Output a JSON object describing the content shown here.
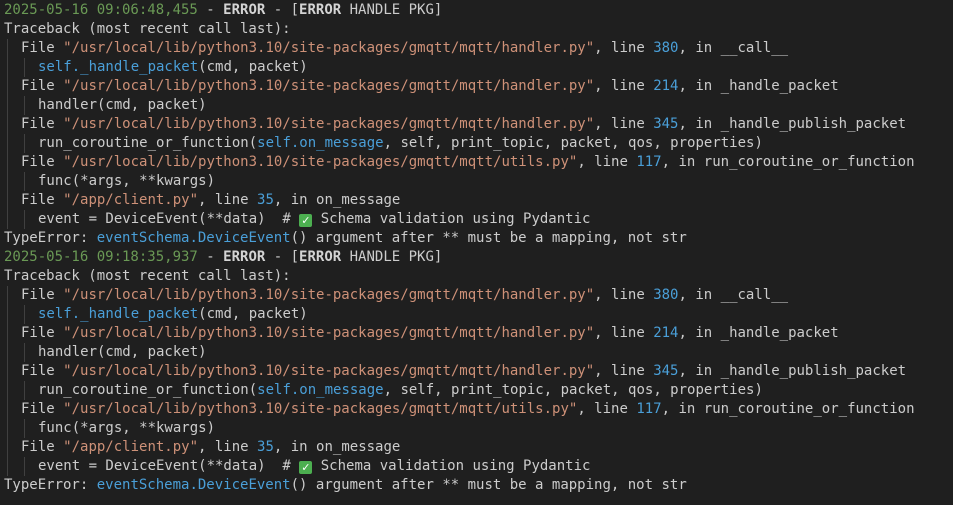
{
  "entries": [
    {
      "timestamp": "2025-05-16 09:06:48,455",
      "level": "ERROR",
      "tag_error": "ERROR",
      "tag_rest": " HANDLE PKG]",
      "traceback_header": "Traceback (most recent call last):",
      "frames": [
        {
          "file": "\"/usr/local/lib/python3.10/site-packages/gmqtt/mqtt/handler.py\"",
          "line": "380",
          "func": "__call__",
          "code_prefix": "",
          "code_ref": "self._handle_packet",
          "code_suffix": "(cmd, packet)"
        },
        {
          "file": "\"/usr/local/lib/python3.10/site-packages/gmqtt/mqtt/handler.py\"",
          "line": "214",
          "func": "_handle_packet",
          "code_prefix": "handler(cmd, packet)",
          "code_ref": "",
          "code_suffix": ""
        },
        {
          "file": "\"/usr/local/lib/python3.10/site-packages/gmqtt/mqtt/handler.py\"",
          "line": "345",
          "func": "_handle_publish_packet",
          "code_prefix": "run_coroutine_or_function(",
          "code_ref": "self.on_message",
          "code_suffix": ", self, print_topic, packet, qos, properties)"
        },
        {
          "file": "\"/usr/local/lib/python3.10/site-packages/gmqtt/mqtt/utils.py\"",
          "line": "117",
          "func": "run_coroutine_or_function",
          "code_prefix": "func(*args, **kwargs)",
          "code_ref": "",
          "code_suffix": ""
        },
        {
          "file": "\"/app/client.py\"",
          "line": "35",
          "func": "on_message",
          "code_prefix": "event = DeviceEvent(**data)  # ",
          "code_ref": "",
          "code_suffix": " Schema validation using Pydantic",
          "check": true
        }
      ],
      "error_type": "TypeError:",
      "error_ref": "eventSchema.DeviceEvent",
      "error_msg": "() argument after ** must be a mapping, not str"
    },
    {
      "timestamp": "2025-05-16 09:18:35,937",
      "level": "ERROR",
      "tag_error": "ERROR",
      "tag_rest": " HANDLE PKG]",
      "traceback_header": "Traceback (most recent call last):",
      "frames": [
        {
          "file": "\"/usr/local/lib/python3.10/site-packages/gmqtt/mqtt/handler.py\"",
          "line": "380",
          "func": "__call__",
          "code_prefix": "",
          "code_ref": "self._handle_packet",
          "code_suffix": "(cmd, packet)"
        },
        {
          "file": "\"/usr/local/lib/python3.10/site-packages/gmqtt/mqtt/handler.py\"",
          "line": "214",
          "func": "_handle_packet",
          "code_prefix": "handler(cmd, packet)",
          "code_ref": "",
          "code_suffix": ""
        },
        {
          "file": "\"/usr/local/lib/python3.10/site-packages/gmqtt/mqtt/handler.py\"",
          "line": "345",
          "func": "_handle_publish_packet",
          "code_prefix": "run_coroutine_or_function(",
          "code_ref": "self.on_message",
          "code_suffix": ", self, print_topic, packet, qos, properties)"
        },
        {
          "file": "\"/usr/local/lib/python3.10/site-packages/gmqtt/mqtt/utils.py\"",
          "line": "117",
          "func": "run_coroutine_or_function",
          "code_prefix": "func(*args, **kwargs)",
          "code_ref": "",
          "code_suffix": ""
        },
        {
          "file": "\"/app/client.py\"",
          "line": "35",
          "func": "on_message",
          "code_prefix": "event = DeviceEvent(**data)  # ",
          "code_ref": "",
          "code_suffix": " Schema validation using Pydantic",
          "check": true
        }
      ],
      "error_type": "TypeError:",
      "error_ref": "eventSchema.DeviceEvent",
      "error_msg": "() argument after ** must be a mapping, not str"
    }
  ],
  "labels": {
    "file_kw": "File ",
    "line_kw": ", line ",
    "in_kw": ", in ",
    "sep": " - ",
    "tag_open": " - [",
    "check_glyph": "✓"
  },
  "colors": {
    "background": "#1f1f1f",
    "text": "#cccccc",
    "timestamp": "#6a9955",
    "string": "#ce9178",
    "number": "#4a9fd8",
    "check": "#4caf50"
  },
  "icons": [
    "check-mark-icon"
  ]
}
